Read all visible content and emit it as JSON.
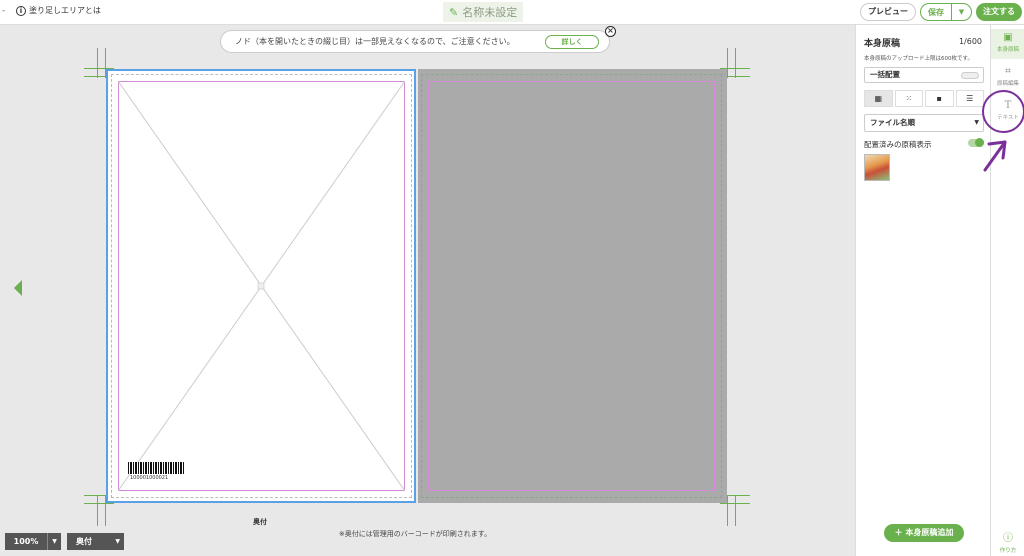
{
  "topbar": {
    "dash": "-",
    "info_label": "塗り足しエリアとは",
    "title": "名称未設定",
    "preview_label": "プレビュー",
    "save_label": "保存",
    "order_label": "注文する"
  },
  "notice": {
    "text": "ノド（本を開いたときの綴じ目）は一部見えなくなるので、ご注意ください。",
    "detail_label": "詳しく"
  },
  "canvas": {
    "barcode_number": "100001000021",
    "okuzuke_label": "奥付",
    "barcode_note": "※奥付には管理用のバーコードが印刷されます。"
  },
  "bottom": {
    "zoom_value": "100%",
    "page_select": "奥付"
  },
  "panel": {
    "title": "本身原稿",
    "count": "1/600",
    "subtitle": "本身原稿のアップロード上限は600枚です。",
    "bulk_label": "一括配置",
    "sort_label": "ファイル名順",
    "placed_label": "配置済みの原稿表示",
    "add_button": "＋ 本身原稿追加"
  },
  "rail": {
    "items": [
      {
        "label": "本身原稿",
        "icon": "image-icon"
      },
      {
        "label": "原稿編集",
        "icon": "crop-icon"
      },
      {
        "label": "テキスト",
        "icon": "text-icon"
      },
      {
        "label": "作り方",
        "icon": "help-icon"
      }
    ]
  },
  "colors": {
    "accent": "#6ab04c",
    "selection": "#5aa0e6",
    "trim": "#d58ad8",
    "annotation": "#7a2f9a"
  }
}
